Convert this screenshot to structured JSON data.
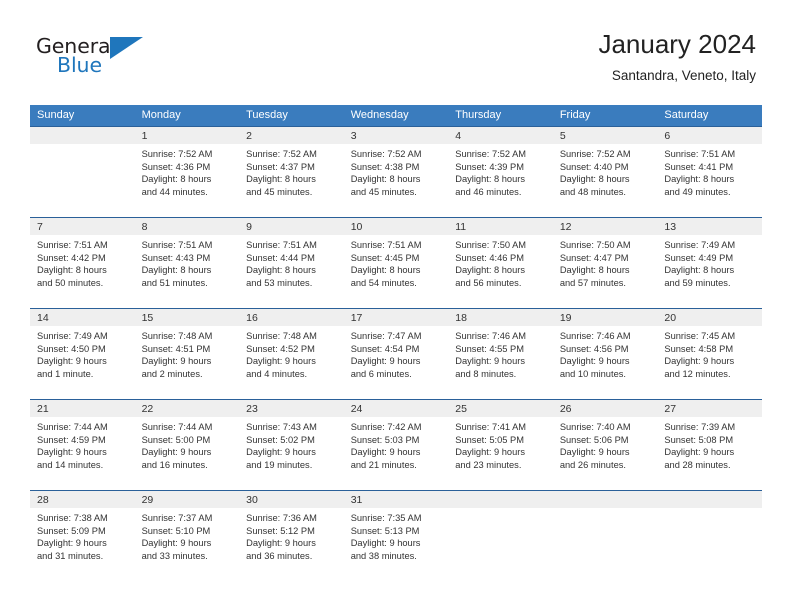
{
  "brand": {
    "name_top": "General",
    "name_bottom": "Blue",
    "triangle_color": "#1f76bc",
    "text_color": "#231f20"
  },
  "header": {
    "title": "January 2024",
    "subtitle": "Santandra, Veneto, Italy"
  },
  "colors": {
    "header_row_bg": "#3a7cbe",
    "header_row_text": "#ffffff",
    "day_number_band_bg": "#efefef",
    "cell_divider": "#2a6099",
    "body_text": "#333333"
  },
  "weekday_headers": [
    "Sunday",
    "Monday",
    "Tuesday",
    "Wednesday",
    "Thursday",
    "Friday",
    "Saturday"
  ],
  "weeks": [
    [
      {
        "day": "",
        "lines": []
      },
      {
        "day": "1",
        "lines": [
          "Sunrise: 7:52 AM",
          "Sunset: 4:36 PM",
          "Daylight: 8 hours",
          "and 44 minutes."
        ]
      },
      {
        "day": "2",
        "lines": [
          "Sunrise: 7:52 AM",
          "Sunset: 4:37 PM",
          "Daylight: 8 hours",
          "and 45 minutes."
        ]
      },
      {
        "day": "3",
        "lines": [
          "Sunrise: 7:52 AM",
          "Sunset: 4:38 PM",
          "Daylight: 8 hours",
          "and 45 minutes."
        ]
      },
      {
        "day": "4",
        "lines": [
          "Sunrise: 7:52 AM",
          "Sunset: 4:39 PM",
          "Daylight: 8 hours",
          "and 46 minutes."
        ]
      },
      {
        "day": "5",
        "lines": [
          "Sunrise: 7:52 AM",
          "Sunset: 4:40 PM",
          "Daylight: 8 hours",
          "and 48 minutes."
        ]
      },
      {
        "day": "6",
        "lines": [
          "Sunrise: 7:51 AM",
          "Sunset: 4:41 PM",
          "Daylight: 8 hours",
          "and 49 minutes."
        ]
      }
    ],
    [
      {
        "day": "7",
        "lines": [
          "Sunrise: 7:51 AM",
          "Sunset: 4:42 PM",
          "Daylight: 8 hours",
          "and 50 minutes."
        ]
      },
      {
        "day": "8",
        "lines": [
          "Sunrise: 7:51 AM",
          "Sunset: 4:43 PM",
          "Daylight: 8 hours",
          "and 51 minutes."
        ]
      },
      {
        "day": "9",
        "lines": [
          "Sunrise: 7:51 AM",
          "Sunset: 4:44 PM",
          "Daylight: 8 hours",
          "and 53 minutes."
        ]
      },
      {
        "day": "10",
        "lines": [
          "Sunrise: 7:51 AM",
          "Sunset: 4:45 PM",
          "Daylight: 8 hours",
          "and 54 minutes."
        ]
      },
      {
        "day": "11",
        "lines": [
          "Sunrise: 7:50 AM",
          "Sunset: 4:46 PM",
          "Daylight: 8 hours",
          "and 56 minutes."
        ]
      },
      {
        "day": "12",
        "lines": [
          "Sunrise: 7:50 AM",
          "Sunset: 4:47 PM",
          "Daylight: 8 hours",
          "and 57 minutes."
        ]
      },
      {
        "day": "13",
        "lines": [
          "Sunrise: 7:49 AM",
          "Sunset: 4:49 PM",
          "Daylight: 8 hours",
          "and 59 minutes."
        ]
      }
    ],
    [
      {
        "day": "14",
        "lines": [
          "Sunrise: 7:49 AM",
          "Sunset: 4:50 PM",
          "Daylight: 9 hours",
          "and 1 minute."
        ]
      },
      {
        "day": "15",
        "lines": [
          "Sunrise: 7:48 AM",
          "Sunset: 4:51 PM",
          "Daylight: 9 hours",
          "and 2 minutes."
        ]
      },
      {
        "day": "16",
        "lines": [
          "Sunrise: 7:48 AM",
          "Sunset: 4:52 PM",
          "Daylight: 9 hours",
          "and 4 minutes."
        ]
      },
      {
        "day": "17",
        "lines": [
          "Sunrise: 7:47 AM",
          "Sunset: 4:54 PM",
          "Daylight: 9 hours",
          "and 6 minutes."
        ]
      },
      {
        "day": "18",
        "lines": [
          "Sunrise: 7:46 AM",
          "Sunset: 4:55 PM",
          "Daylight: 9 hours",
          "and 8 minutes."
        ]
      },
      {
        "day": "19",
        "lines": [
          "Sunrise: 7:46 AM",
          "Sunset: 4:56 PM",
          "Daylight: 9 hours",
          "and 10 minutes."
        ]
      },
      {
        "day": "20",
        "lines": [
          "Sunrise: 7:45 AM",
          "Sunset: 4:58 PM",
          "Daylight: 9 hours",
          "and 12 minutes."
        ]
      }
    ],
    [
      {
        "day": "21",
        "lines": [
          "Sunrise: 7:44 AM",
          "Sunset: 4:59 PM",
          "Daylight: 9 hours",
          "and 14 minutes."
        ]
      },
      {
        "day": "22",
        "lines": [
          "Sunrise: 7:44 AM",
          "Sunset: 5:00 PM",
          "Daylight: 9 hours",
          "and 16 minutes."
        ]
      },
      {
        "day": "23",
        "lines": [
          "Sunrise: 7:43 AM",
          "Sunset: 5:02 PM",
          "Daylight: 9 hours",
          "and 19 minutes."
        ]
      },
      {
        "day": "24",
        "lines": [
          "Sunrise: 7:42 AM",
          "Sunset: 5:03 PM",
          "Daylight: 9 hours",
          "and 21 minutes."
        ]
      },
      {
        "day": "25",
        "lines": [
          "Sunrise: 7:41 AM",
          "Sunset: 5:05 PM",
          "Daylight: 9 hours",
          "and 23 minutes."
        ]
      },
      {
        "day": "26",
        "lines": [
          "Sunrise: 7:40 AM",
          "Sunset: 5:06 PM",
          "Daylight: 9 hours",
          "and 26 minutes."
        ]
      },
      {
        "day": "27",
        "lines": [
          "Sunrise: 7:39 AM",
          "Sunset: 5:08 PM",
          "Daylight: 9 hours",
          "and 28 minutes."
        ]
      }
    ],
    [
      {
        "day": "28",
        "lines": [
          "Sunrise: 7:38 AM",
          "Sunset: 5:09 PM",
          "Daylight: 9 hours",
          "and 31 minutes."
        ]
      },
      {
        "day": "29",
        "lines": [
          "Sunrise: 7:37 AM",
          "Sunset: 5:10 PM",
          "Daylight: 9 hours",
          "and 33 minutes."
        ]
      },
      {
        "day": "30",
        "lines": [
          "Sunrise: 7:36 AM",
          "Sunset: 5:12 PM",
          "Daylight: 9 hours",
          "and 36 minutes."
        ]
      },
      {
        "day": "31",
        "lines": [
          "Sunrise: 7:35 AM",
          "Sunset: 5:13 PM",
          "Daylight: 9 hours",
          "and 38 minutes."
        ]
      },
      {
        "day": "",
        "lines": []
      },
      {
        "day": "",
        "lines": []
      },
      {
        "day": "",
        "lines": []
      }
    ]
  ]
}
